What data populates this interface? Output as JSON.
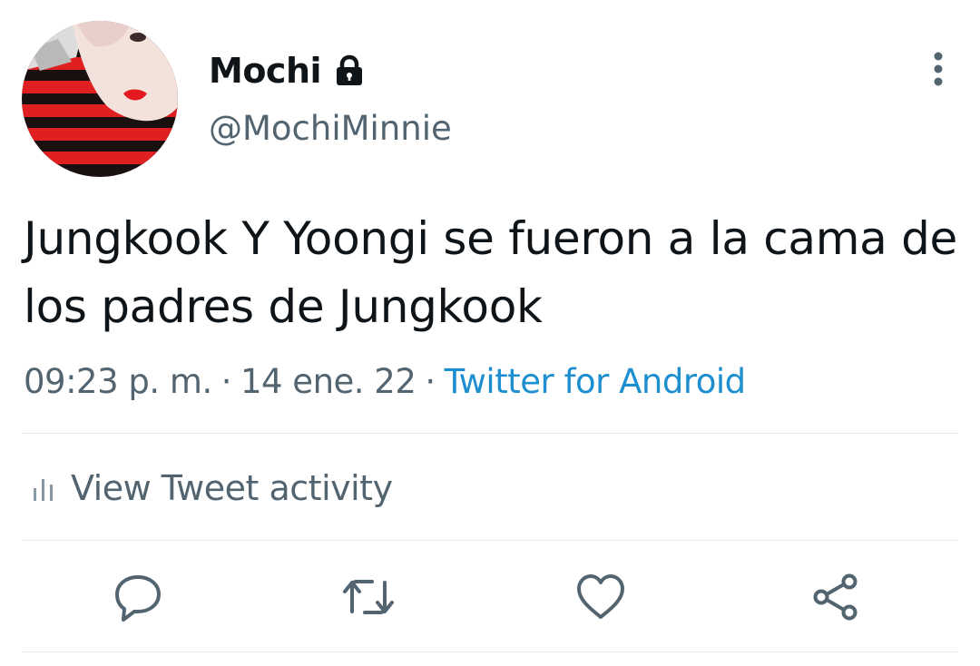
{
  "tweet": {
    "display_name": "Mochi",
    "handle": "@MochiMinnie",
    "text": "Jungkook Y Yoongi se fueron a la cama de los padres de Jungkook",
    "time": "09:23 p. m.",
    "separator": "·",
    "date": "14 ene. 22",
    "source": "Twitter for Android"
  },
  "activity": {
    "label": "View Tweet activity"
  },
  "icons": {
    "protected": "lock-icon",
    "more": "more-vertical-icon",
    "activity": "bar-chart-icon",
    "reply": "reply-icon",
    "retweet": "retweet-icon",
    "like": "heart-icon",
    "share": "share-icon"
  },
  "colors": {
    "text": "#0f1419",
    "secondary": "#536471",
    "link": "#1d8fd0",
    "divider": "#e4e8eb"
  }
}
